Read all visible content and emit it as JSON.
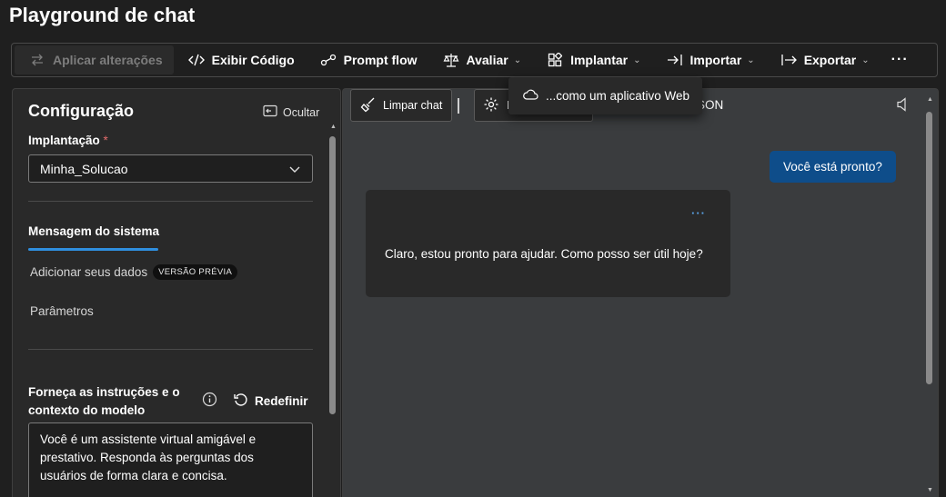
{
  "app_title": "Playground de chat",
  "toolbar": {
    "apply": "Aplicar alterações",
    "view_code": "Exibir Código",
    "prompt_flow": "Prompt flow",
    "evaluate": "Avaliar",
    "deploy": "Implantar",
    "import": "Importar",
    "export": "Exportar",
    "more": "···"
  },
  "deploy_menu": {
    "items": [
      {
        "label": "...como um aplicativo Web",
        "icon": "cloud-icon"
      }
    ]
  },
  "config": {
    "title": "Configuração",
    "hide": "Ocultar",
    "deployment_label": "Implantação",
    "required_mark": "*",
    "deployment_value": "Minha_Solucao",
    "tabs": {
      "system_message": "Mensagem do sistema",
      "add_data": "Adicionar seus dados",
      "preview_badge": "VERSÃO PRÉVIA",
      "parameters": "Parâmetros"
    },
    "instructions_label": "Forneça as instruções e o contexto do modelo",
    "reset": "Redefinir",
    "system_prompt": "Você é um assistente virtual amigável e prestativo. Responda às perguntas dos usuários de forma clara e concisa."
  },
  "chat": {
    "clear": "Limpar chat",
    "params_partial": "R",
    "json_partial": "SON",
    "user_message": "Você está pronto?",
    "assistant_message": "Claro, estou pronto para ajudar. Como posso ser útil hoje?",
    "more": "···"
  },
  "colors": {
    "background": "#1f1f1f",
    "panel": "#292929",
    "chat_area": "#3a3c3e",
    "accent": "#2f8fdf",
    "user_bubble": "#0e4d8a"
  }
}
